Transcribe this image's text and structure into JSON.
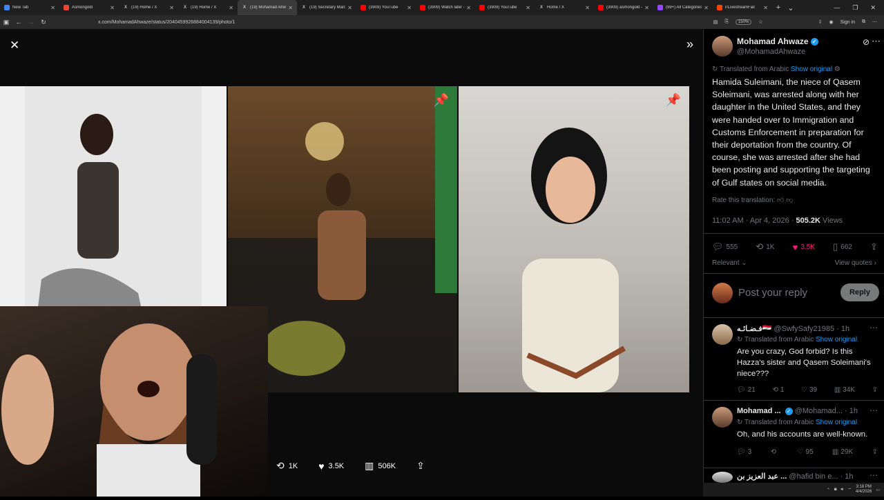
{
  "browser": {
    "tabs": [
      {
        "label": "New Tab",
        "color": "#4285f4",
        "icon": "newtab-icon"
      },
      {
        "label": "Asmongold",
        "color": "#e43",
        "icon": "site-icon"
      },
      {
        "label": "(19) Home / X",
        "color": "#000",
        "icon": "x-icon"
      },
      {
        "label": "(19) Home / X",
        "color": "#000",
        "icon": "x-icon"
      },
      {
        "label": "(19) Mohamad Ahwaz",
        "color": "#000",
        "icon": "x-icon",
        "active": true
      },
      {
        "label": "(19) Secretary Marco",
        "color": "#000",
        "icon": "x-icon"
      },
      {
        "label": "(3909) YouTube",
        "color": "#f00",
        "icon": "youtube-icon"
      },
      {
        "label": "(3909) Watch later - Y",
        "color": "#f00",
        "icon": "youtube-icon"
      },
      {
        "label": "(3909) YouTube",
        "color": "#f00",
        "icon": "youtube-icon"
      },
      {
        "label": "Home / X",
        "color": "#000",
        "icon": "x-icon"
      },
      {
        "label": "(3909) asmongold - Y",
        "color": "#f00",
        "icon": "youtube-icon"
      },
      {
        "label": "(99+) All Categories -",
        "color": "#9146ff",
        "icon": "twitch-icon"
      },
      {
        "label": "r/LivestreamFail",
        "color": "#ff4500",
        "icon": "reddit-icon"
      }
    ],
    "url": "x.com/MohamadAhwaze/status/2040459926884004139/photo/1",
    "zoom": "150%",
    "signin": "Sign in"
  },
  "media": {
    "actions": {
      "retweets": "1K",
      "likes": "3.5K",
      "views": "506K"
    }
  },
  "post": {
    "author_name": "Mohamad Ahwaze",
    "author_handle": "@MohamadAhwaze",
    "translated_from": "Translated from Arabic",
    "show_original": "Show original",
    "body": "Hamida Suleimani, the niece of Qasem Soleimani, was arrested along with her daughter in the United States, and they were handed over to Immigration and Customs Enforcement in preparation for their deportation from the country. Of course, she was arrested after she had been posting and supporting the targeting of Gulf states on social media.",
    "rate_translation": "Rate this translation:",
    "timestamp": "11:02 AM · Apr 4, 2026 · ",
    "views_count": "505.2K",
    "views_label": "Views",
    "stats": {
      "replies": "555",
      "reposts": "1K",
      "likes": "3.5K",
      "bookmarks": "662"
    },
    "sort_label": "Relevant",
    "view_quotes": "View quotes"
  },
  "reply_box": {
    "placeholder": "Post your reply",
    "button": "Reply"
  },
  "replies": [
    {
      "name": "فـضـائـه🇮🇶",
      "handle": "@SwfySafy21985 · 1h",
      "translated": "Translated from Arabic",
      "show_original": "Show original",
      "text": "Are you crazy, God forbid? Is this Hazza's sister and Qasem Soleimani's niece???",
      "stats": {
        "replies": "21",
        "reposts": "1",
        "likes": "39",
        "views": "34K"
      }
    },
    {
      "name": "Mohamad ...",
      "handle": "@Mohamad... · 1h",
      "translated": "Translated from Arabic",
      "show_original": "Show original",
      "text": "Oh, and his accounts are well-known.",
      "stats": {
        "replies": "3",
        "reposts": "",
        "likes": "95",
        "views": "29K"
      }
    },
    {
      "name": "عبد العزيز بن ...",
      "handle": "@hafid bin e... · 1h"
    }
  ],
  "taskbar": {
    "time": "3:18 PM",
    "date": "4/4/2026"
  },
  "colors": {
    "accent": "#1d9bf0",
    "like": "#f91880",
    "background": "#000000"
  }
}
